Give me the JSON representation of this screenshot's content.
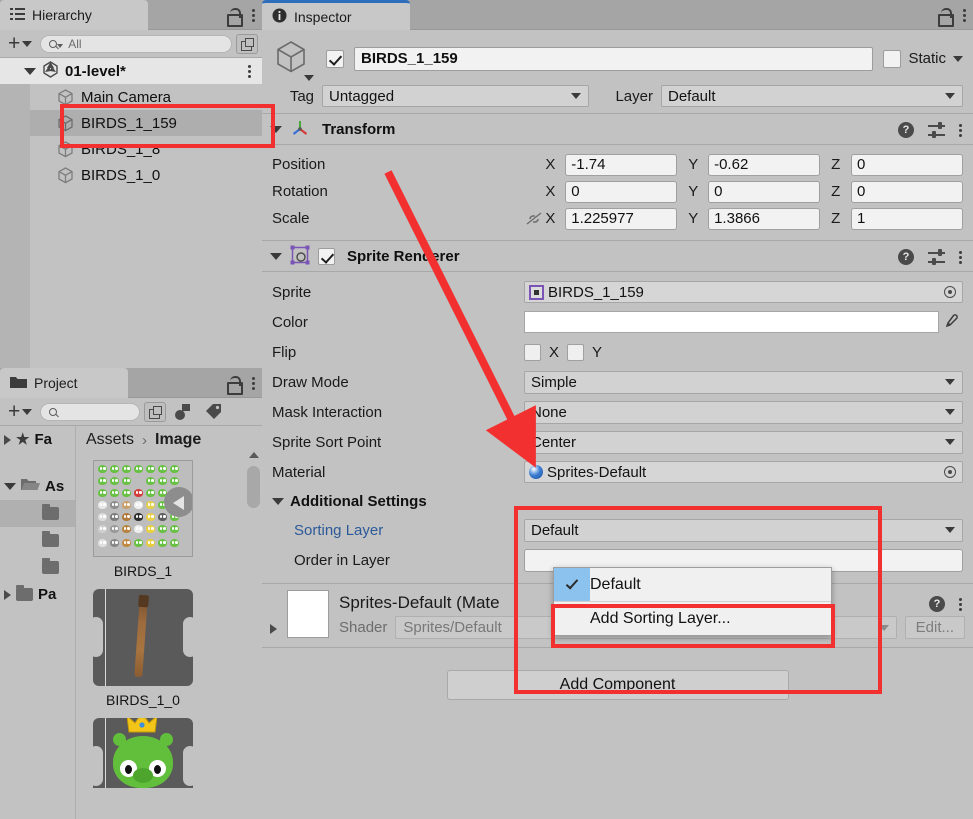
{
  "hierarchy": {
    "tab_label": "Hierarchy",
    "toolbar": {
      "add_label": "+",
      "search_placeholder": "All",
      "search_value": ""
    },
    "scene": {
      "name": "01-level*",
      "expanded": true
    },
    "objects": [
      {
        "name": "Main Camera",
        "selected": false
      },
      {
        "name": "BIRDS_1_159",
        "selected": true
      },
      {
        "name": "BIRDS_1_8",
        "selected": false
      },
      {
        "name": "BIRDS_1_0",
        "selected": false
      }
    ]
  },
  "project": {
    "tab_label": "Project",
    "toolbar": {
      "add_label": "+",
      "search_value": ""
    },
    "tree": [
      {
        "label": "Fa",
        "expanded": false,
        "icon": "star-icon",
        "selected": false
      },
      {
        "label": "As",
        "expanded": true,
        "icon": "folder-open-icon",
        "selected": false
      },
      {
        "label": "",
        "expanded": null,
        "icon": "folder-icon",
        "selected": true
      },
      {
        "label": "",
        "expanded": null,
        "icon": "folder-icon",
        "selected": false
      },
      {
        "label": "",
        "expanded": null,
        "icon": "folder-icon",
        "selected": false
      },
      {
        "label": "Pa",
        "expanded": false,
        "icon": "folder-icon",
        "selected": false
      }
    ],
    "breadcrumb": {
      "root": "Assets",
      "separator": "›",
      "current": "Image"
    },
    "assets": [
      {
        "name": "BIRDS_1",
        "kind": "spritesheet"
      },
      {
        "name": "BIRDS_1_0",
        "kind": "sprite-stick"
      },
      {
        "name": "",
        "kind": "sprite-pig"
      }
    ]
  },
  "inspector": {
    "tab_label": "Inspector",
    "object": {
      "enabled": true,
      "name": "BIRDS_1_159",
      "static_label": "Static",
      "static_checked": false,
      "tag_label": "Tag",
      "tag_value": "Untagged",
      "layer_label": "Layer",
      "layer_value": "Default"
    },
    "transform": {
      "title": "Transform",
      "expanded": true,
      "rows": [
        {
          "label": "Position",
          "x": "-1.74",
          "y": "-0.62",
          "z": "0",
          "has_link": false
        },
        {
          "label": "Rotation",
          "x": "0",
          "y": "0",
          "z": "0",
          "has_link": false
        },
        {
          "label": "Scale",
          "x": "1.225977",
          "y": "1.3866",
          "z": "1",
          "has_link": true
        }
      ],
      "axes": [
        "X",
        "Y",
        "Z"
      ]
    },
    "sprite_renderer": {
      "title": "Sprite Renderer",
      "expanded": true,
      "enabled": true,
      "sprite_label": "Sprite",
      "sprite_value": "BIRDS_1_159",
      "color_label": "Color",
      "color_value": "#FFFFFF",
      "flip_label": "Flip",
      "flip_x_label": "X",
      "flip_y_label": "Y",
      "flip_x": false,
      "flip_y": false,
      "draw_mode_label": "Draw Mode",
      "draw_mode_value": "Simple",
      "mask_interaction_label": "Mask Interaction",
      "mask_interaction_value": "None",
      "sprite_sort_point_label": "Sprite Sort Point",
      "sprite_sort_point_value": "Center",
      "material_label": "Material",
      "material_value": "Sprites-Default",
      "additional_settings_label": "Additional Settings",
      "sorting_layer_label": "Sorting Layer",
      "sorting_layer_value": "Default",
      "order_in_layer_label": "Order in Layer",
      "order_in_layer_value": ""
    },
    "material": {
      "title": "Sprites-Default (Mate",
      "shader_label": "Shader",
      "shader_value": "Sprites/Default",
      "edit_label": "Edit..."
    },
    "add_component_label": "Add Component"
  },
  "dropdown": {
    "items": [
      {
        "label": "Default",
        "checked": true
      },
      {
        "label": "Add Sorting Layer...",
        "checked": false
      }
    ]
  },
  "colors": {
    "accent_blue": "#2e6fbd",
    "annotation_red": "#f23030",
    "selection_blue": "#8cc2ee",
    "link_blue": "#2c5a99",
    "panel_bg": "#c2c2c2"
  }
}
